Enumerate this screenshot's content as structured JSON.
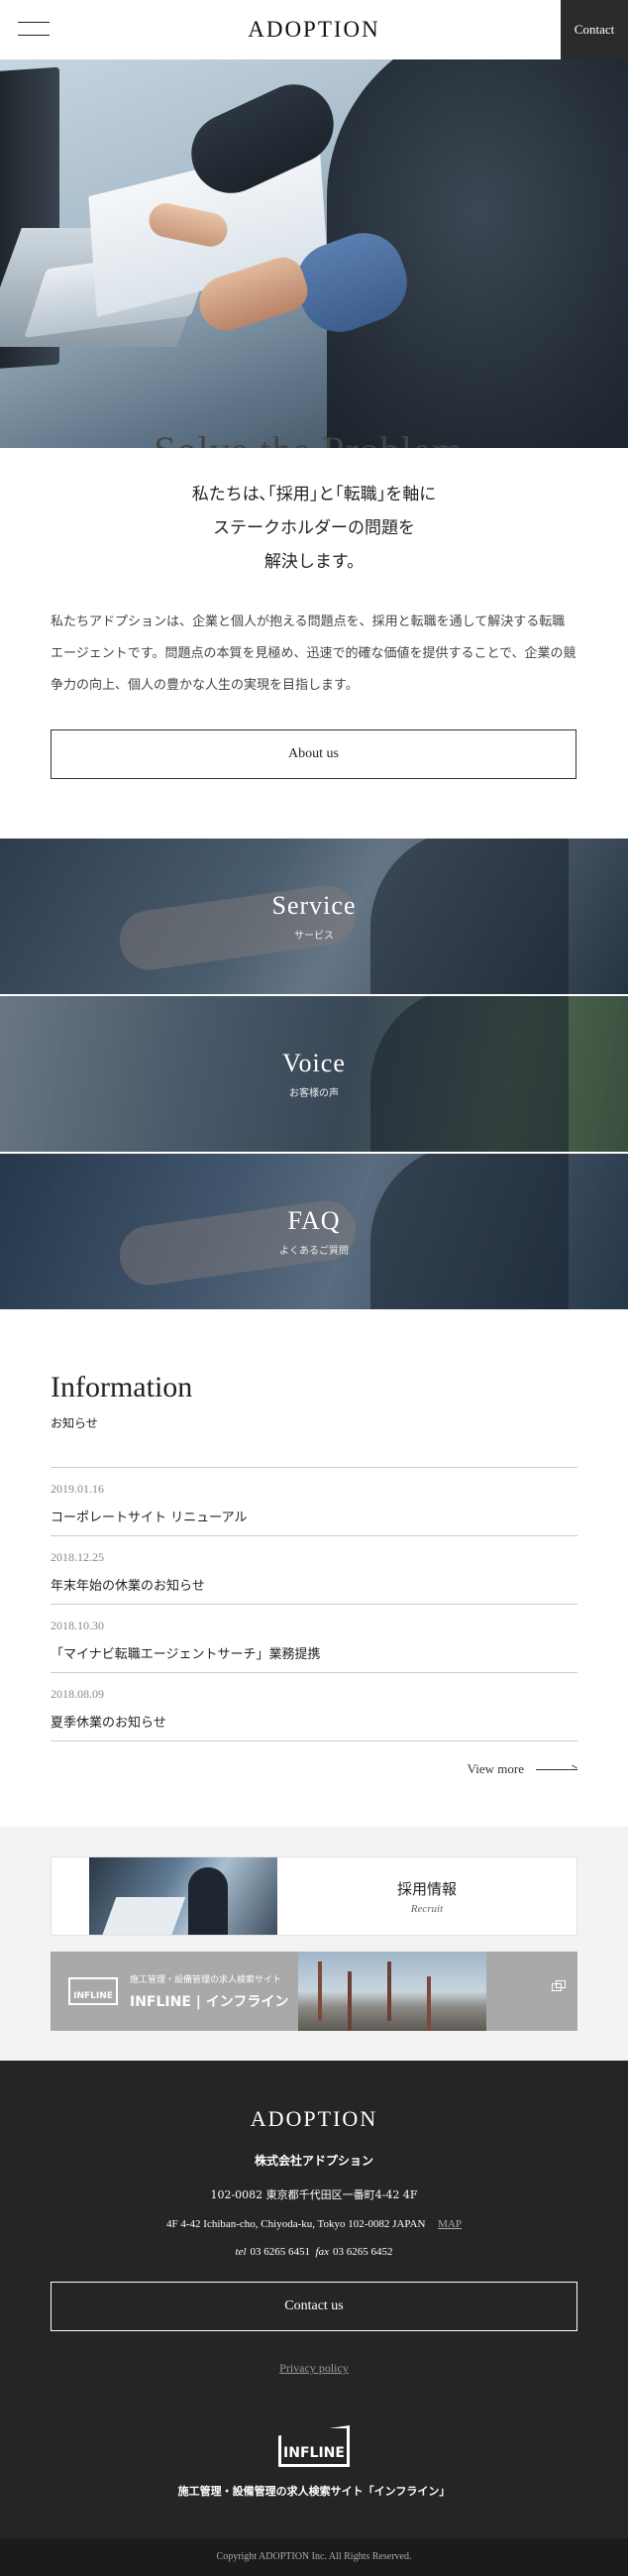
{
  "header": {
    "logo": "ADOPTION",
    "contact_label": "Contact"
  },
  "hero": {
    "title": "Solve the Problem."
  },
  "intro": {
    "lead_line1": "私たちは､｢採用｣と｢転職｣を軸に",
    "lead_line2": "ステークホルダーの問題を",
    "lead_line3": "解決します。",
    "body": "私たちアドプションは、企業と個人が抱える問題点を、採用と転職を通して解決する転職エージェントです。問題点の本質を見極め、迅速で的確な価値を提供することで、企業の競争力の向上、個人の豊かな人生の実現を目指します。",
    "button_label": "About us"
  },
  "banners": [
    {
      "title": "Service",
      "subtitle": "サービス"
    },
    {
      "title": "Voice",
      "subtitle": "お客様の声"
    },
    {
      "title": "FAQ",
      "subtitle": "よくあるご質問"
    }
  ],
  "information": {
    "title": "Information",
    "subtitle": "お知らせ",
    "items": [
      {
        "date": "2019.01.16",
        "title": "コーポレートサイト リニューアル"
      },
      {
        "date": "2018.12.25",
        "title": "年末年始の休業のお知らせ"
      },
      {
        "date": "2018.10.30",
        "title": "「マイナビ転職エージェントサーチ」業務提携"
      },
      {
        "date": "2018.08.09",
        "title": "夏季休業のお知らせ"
      }
    ],
    "view_more": "View more"
  },
  "recruit": {
    "title": "採用情報",
    "subtitle": "Recruit"
  },
  "infline_banner": {
    "logo_text": "INFLINE",
    "caption": "施工管理・設備管理の求人検索サイト",
    "name": "INFLINE | インフライン"
  },
  "footer": {
    "logo": "ADOPTION",
    "company": "株式会社アドプション",
    "address_jp": "102-0082 東京都千代田区一番町4-42 4F",
    "address_en": "4F 4-42 Ichiban-cho, Chiyoda-ku, Tokyo 102-0082 JAPAN",
    "map_label": "MAP",
    "tel_label": "tel",
    "tel": "03 6265 6451",
    "fax_label": "fax",
    "fax": "03 6265 6452",
    "contact_label": "Contact us",
    "privacy_label": "Privacy policy",
    "infline_logo": "INFLINE",
    "infline_caption": "施工管理・設備管理の求人検索サイト「インフライン」"
  },
  "copyright": "Copyright ADOPTION Inc. All Rights Reserved."
}
